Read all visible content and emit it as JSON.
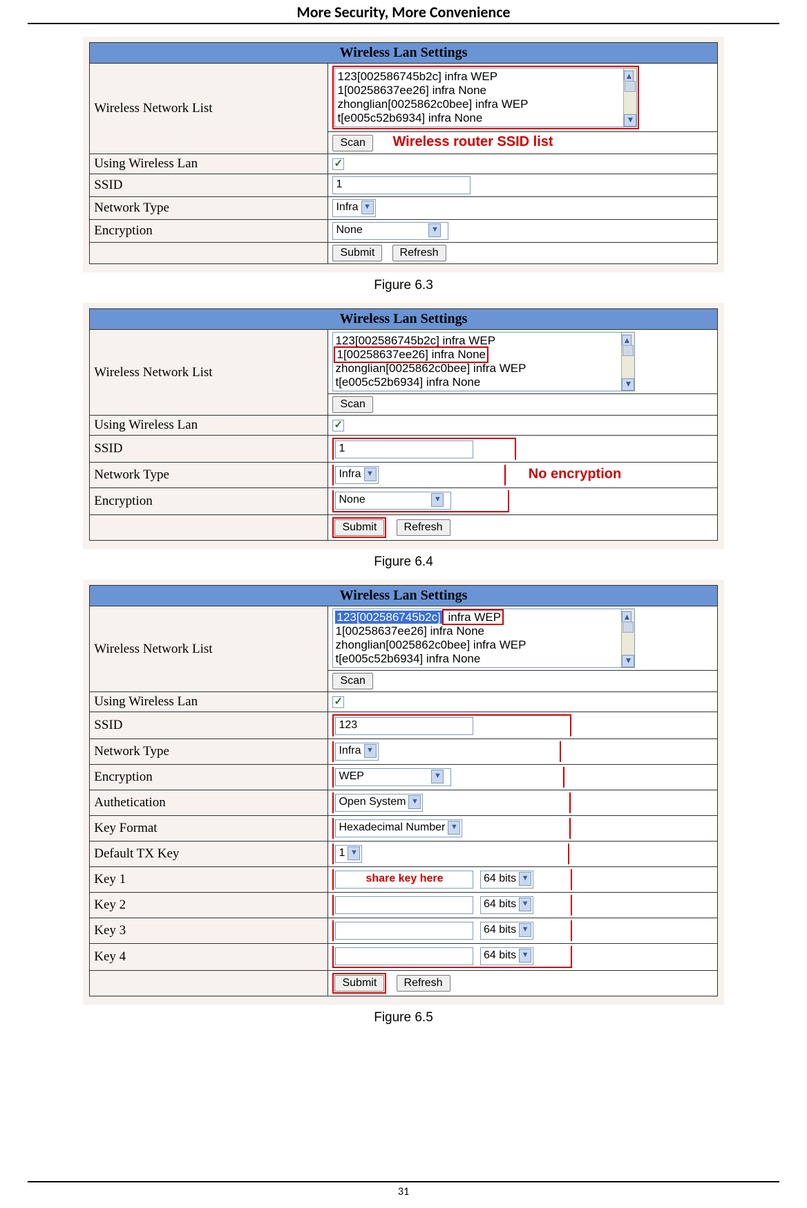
{
  "header": "More Security, More Convenience",
  "pageNumber": "31",
  "listItems": [
    "123[002586745b2c] infra WEP",
    "1[00258637ee26] infra None",
    "zhonglian[0025862c0bee] infra WEP",
    "t[e005c52b6934] infra None"
  ],
  "panelTitle": "Wireless Lan Settings",
  "labels": {
    "wnl": "Wireless Network List",
    "uwl": "Using Wireless Lan",
    "ssid": "SSID",
    "ntype": "Network Type",
    "enc": "Encryption",
    "auth": "Authetication",
    "kfmt": "Key Format",
    "dtxk": "Default TX Key",
    "k1": "Key 1",
    "k2": "Key 2",
    "k3": "Key 3",
    "k4": "Key 4"
  },
  "btns": {
    "scan": "Scan",
    "submit": "Submit",
    "refresh": "Refresh"
  },
  "fig63": {
    "caption": "Figure 6.3",
    "ssid": "1",
    "ntype": "Infra",
    "enc": "None",
    "annot": "Wireless router SSID list"
  },
  "fig64": {
    "caption": "Figure 6.4",
    "ssid": "1",
    "ntype": "Infra",
    "enc": "None",
    "annot": "No encryption"
  },
  "fig65": {
    "caption": "Figure 6.5",
    "ssid": "123",
    "ntype": "Infra",
    "enc": "WEP",
    "auth": "Open System",
    "kfmt": "Hexadecimal Number",
    "dtxk": "1",
    "keyBits": "64 bits",
    "annot": "share key here"
  }
}
